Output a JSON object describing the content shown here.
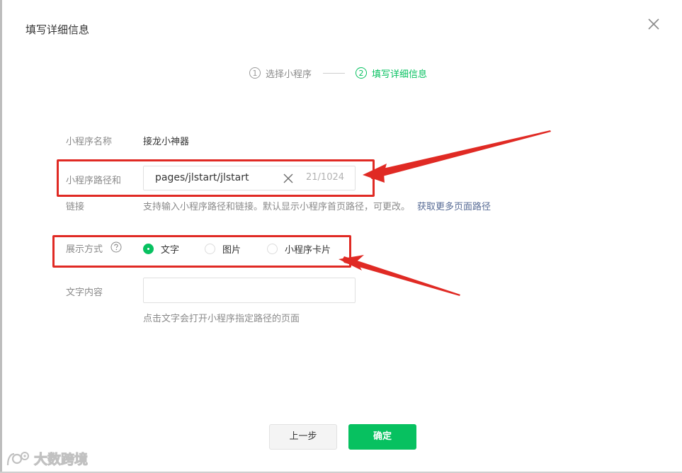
{
  "dialog": {
    "title": "填写详细信息",
    "close_icon": "close-icon"
  },
  "steps": [
    {
      "number": "1",
      "label": "选择小程序",
      "state": "done"
    },
    {
      "number": "2",
      "label": "填写详细信息",
      "state": "active"
    }
  ],
  "form": {
    "name": {
      "label": "小程序名称",
      "value": "接龙小神器"
    },
    "path": {
      "label_line1": "小程序路径和",
      "label_line2": "链接",
      "value": "pages/jlstart/jlstart",
      "count": "21/1024",
      "hint": "支持输入小程序路径和链接。默认显示小程序首页路径，可更改。",
      "hint_link": "获取更多页面路径"
    },
    "display": {
      "label": "展示方式",
      "help_icon": "question-circle-icon",
      "options": [
        {
          "label": "文字",
          "checked": true
        },
        {
          "label": "图片",
          "checked": false
        },
        {
          "label": "小程序卡片",
          "checked": false
        }
      ]
    },
    "text_content": {
      "label": "文字内容",
      "value": "",
      "hint": "点击文字会打开小程序指定路径的页面"
    }
  },
  "buttons": {
    "prev_label": "上一步",
    "ok_label": "确定"
  },
  "watermark": {
    "text": "大数跨境"
  },
  "colors": {
    "brand_green": "#07c160",
    "annotation_red": "#e02a24",
    "link_blue": "#576b95"
  }
}
